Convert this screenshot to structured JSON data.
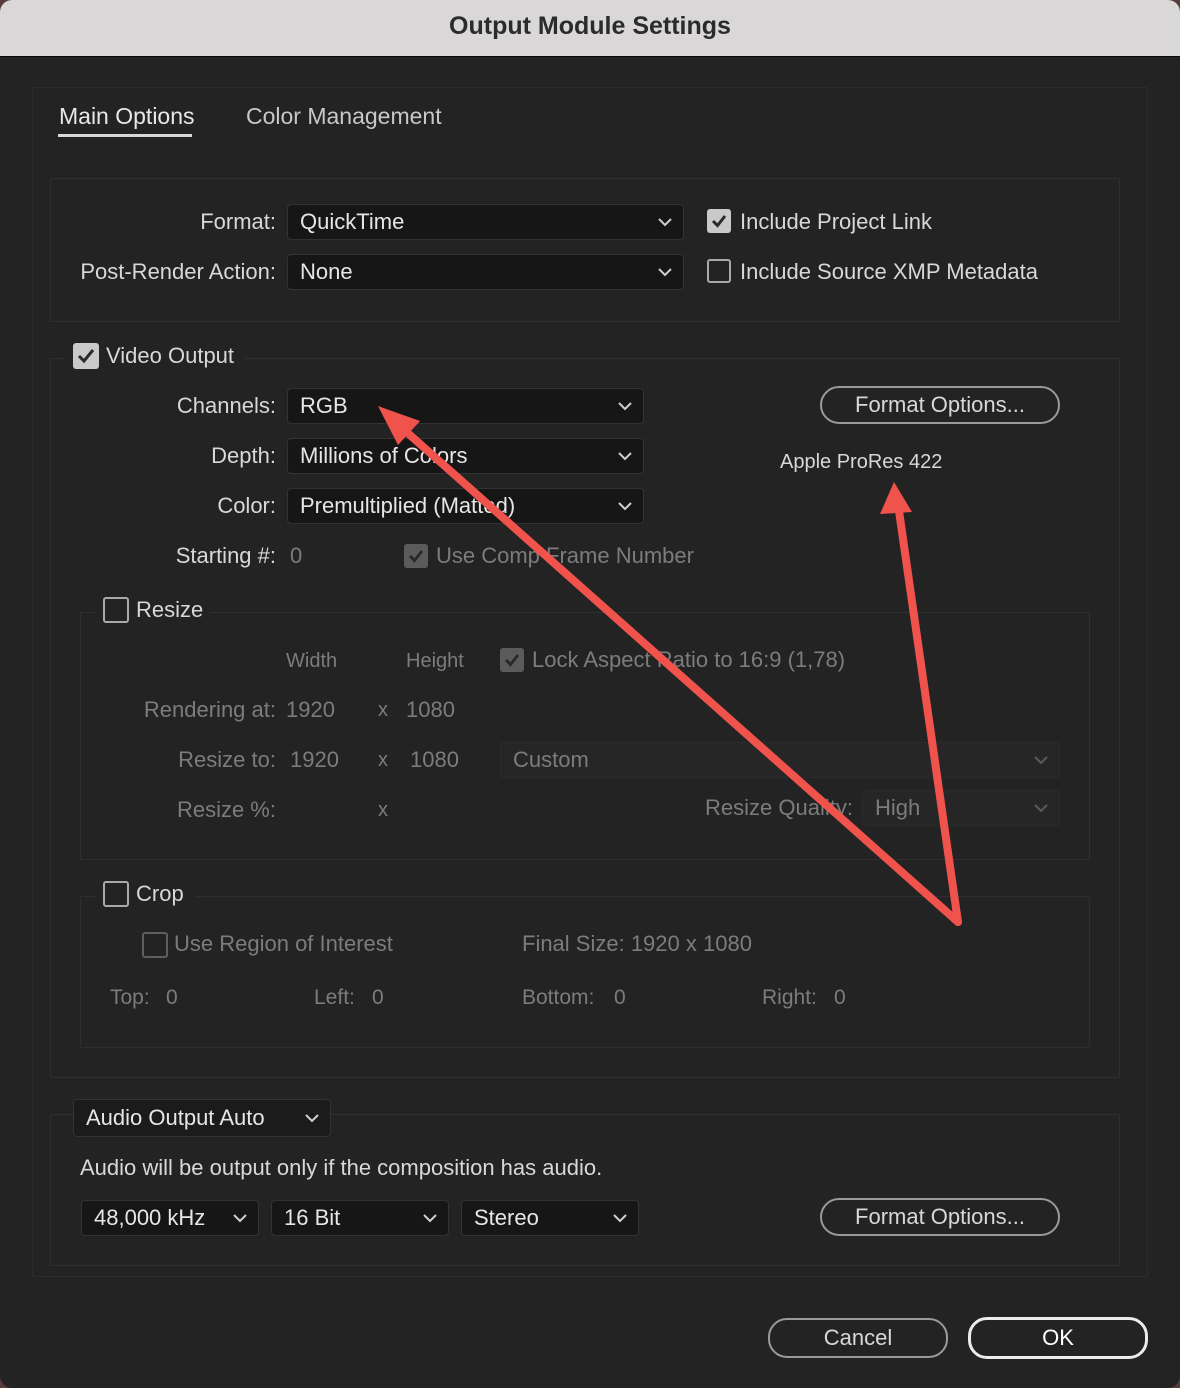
{
  "window": {
    "title": "Output Module Settings"
  },
  "tabs": [
    {
      "label": "Main Options",
      "active": true
    },
    {
      "label": "Color Management",
      "active": false
    }
  ],
  "top": {
    "format_label": "Format:",
    "format_value": "QuickTime",
    "post_render_label": "Post-Render Action:",
    "post_render_value": "None",
    "include_project_link": {
      "label": "Include Project Link",
      "checked": true
    },
    "include_xmp": {
      "label": "Include Source XMP Metadata",
      "checked": false
    }
  },
  "video": {
    "label": "Video Output",
    "checked": true,
    "channels_label": "Channels:",
    "channels_value": "RGB",
    "depth_label": "Depth:",
    "depth_value": "Millions of Colors",
    "color_label": "Color:",
    "color_value": "Premultiplied (Matted)",
    "starting_label": "Starting #:",
    "starting_value": "0",
    "use_comp_frame": {
      "label": "Use Comp Frame Number",
      "checked": true
    },
    "format_options_button": "Format Options...",
    "codec": "Apple ProRes 422"
  },
  "resize": {
    "label": "Resize",
    "checked": false,
    "width_header": "Width",
    "height_header": "Height",
    "lock_aspect": {
      "label": "Lock Aspect Ratio to 16:9 (1,78)",
      "checked": true
    },
    "rendering_label": "Rendering at:",
    "rendering_w": "1920",
    "rendering_h": "1080",
    "resize_to_label": "Resize to:",
    "resize_to_w": "1920",
    "resize_to_h": "1080",
    "preset_value": "Custom",
    "resize_pct_label": "Resize %:",
    "x": "x",
    "quality_label": "Resize Quality:",
    "quality_value": "High"
  },
  "crop": {
    "label": "Crop",
    "checked": false,
    "roi": {
      "label": "Use Region of Interest",
      "checked": false
    },
    "final_size": "Final Size: 1920 x 1080",
    "top_label": "Top:",
    "top_value": "0",
    "left_label": "Left:",
    "left_value": "0",
    "bottom_label": "Bottom:",
    "bottom_value": "0",
    "right_label": "Right:",
    "right_value": "0"
  },
  "audio": {
    "output_value": "Audio Output Auto",
    "note": "Audio will be output only if the composition has audio.",
    "rate_value": "48,000 kHz",
    "bits_value": "16 Bit",
    "channels_value": "Stereo",
    "format_options_button": "Format Options..."
  },
  "footer": {
    "cancel": "Cancel",
    "ok": "OK"
  },
  "colors": {
    "annotation_arrow": "#f0524c",
    "background": "#232323"
  }
}
